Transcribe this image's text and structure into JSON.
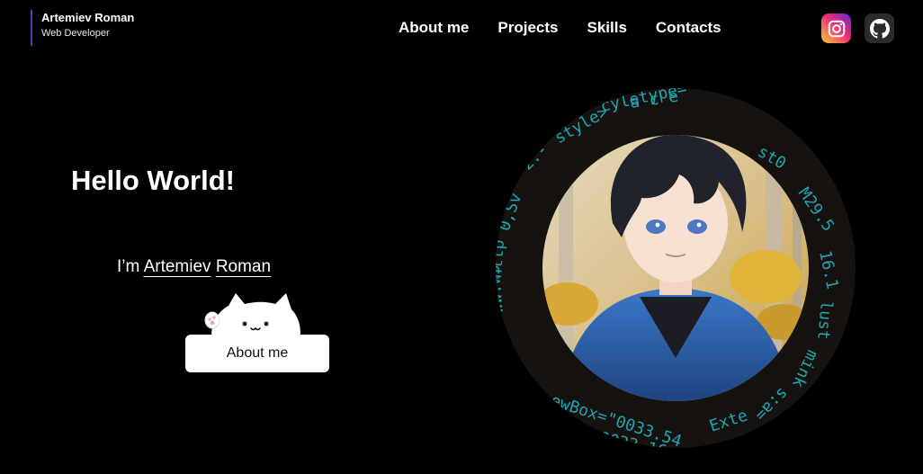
{
  "header": {
    "brand_name": "Artemiev Roman",
    "brand_role": "Web Developer",
    "nav": [
      {
        "label": "About me"
      },
      {
        "label": "Projects"
      },
      {
        "label": "Skills"
      },
      {
        "label": "Contacts"
      }
    ],
    "social": [
      {
        "icon": "instagram-icon"
      },
      {
        "icon": "github-icon"
      }
    ]
  },
  "hero": {
    "title": "Hello World!",
    "intro_prefix": "I’m ",
    "intro_first": "Artemiev",
    "intro_space": " ",
    "intro_last": "Roman",
    "button_label": "About me"
  },
  "colors": {
    "background": "#000000",
    "brand_accent": "#5b3db4",
    "code_text": "#1fb6c4",
    "button_bg": "#ffffff"
  }
}
